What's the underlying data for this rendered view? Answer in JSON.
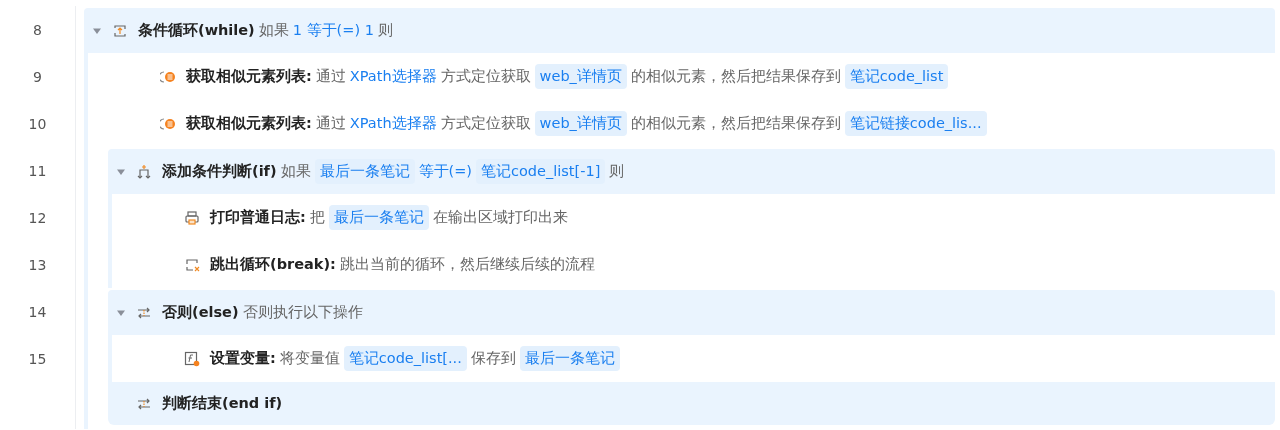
{
  "steps": [
    {
      "line": "8",
      "kind": "while",
      "expanded": true,
      "title": "条件循环(while)",
      "parts": [
        {
          "kind": "text",
          "text": "如果"
        },
        {
          "kind": "link",
          "text": "1 等于(=) 1"
        },
        {
          "kind": "text",
          "text": "则"
        }
      ],
      "children": [
        {
          "line": "9",
          "kind": "get-elements",
          "title": "获取相似元素列表:",
          "parts": [
            {
              "kind": "text",
              "text": "通过"
            },
            {
              "kind": "link",
              "text": "XPath选择器"
            },
            {
              "kind": "text",
              "text": "方式定位获取"
            },
            {
              "kind": "tag",
              "text": "web_详情页"
            },
            {
              "kind": "text",
              "text": "的相似元素，然后把结果保存到"
            },
            {
              "kind": "tag",
              "text": "笔记code_list"
            }
          ]
        },
        {
          "line": "10",
          "kind": "get-elements",
          "title": "获取相似元素列表:",
          "parts": [
            {
              "kind": "text",
              "text": "通过"
            },
            {
              "kind": "link",
              "text": "XPath选择器"
            },
            {
              "kind": "text",
              "text": "方式定位获取"
            },
            {
              "kind": "tag",
              "text": "web_详情页"
            },
            {
              "kind": "text",
              "text": "的相似元素，然后把结果保存到"
            },
            {
              "kind": "tag",
              "text": "笔记链接code_lis..."
            }
          ]
        },
        {
          "line": "11",
          "kind": "if",
          "expanded": true,
          "title": "添加条件判断(if)",
          "parts": [
            {
              "kind": "text",
              "text": "如果"
            },
            {
              "kind": "tag",
              "text": "最后一条笔记"
            },
            {
              "kind": "link",
              "text": "等于(=)"
            },
            {
              "kind": "tag",
              "text": "笔记code_list[-1]"
            },
            {
              "kind": "text",
              "text": "则"
            }
          ],
          "children": [
            {
              "line": "12",
              "kind": "print",
              "title": "打印普通日志:",
              "parts": [
                {
                  "kind": "text",
                  "text": "把"
                },
                {
                  "kind": "tag",
                  "text": "最后一条笔记"
                },
                {
                  "kind": "text",
                  "text": "在输出区域打印出来"
                }
              ]
            },
            {
              "line": "13",
              "kind": "break",
              "title": "跳出循环(break):",
              "parts": [
                {
                  "kind": "text",
                  "text": "跳出当前的循环，然后继续后续的流程"
                }
              ]
            }
          ]
        },
        {
          "line": "14",
          "kind": "else",
          "expanded": true,
          "title": "否则(else)",
          "parts": [
            {
              "kind": "text",
              "text": "否则执行以下操作"
            }
          ],
          "children": [
            {
              "line": "15",
              "kind": "set-variable",
              "title": "设置变量:",
              "parts": [
                {
                  "kind": "text",
                  "text": "将变量值"
                },
                {
                  "kind": "tag",
                  "text": "笔记code_list[..."
                },
                {
                  "kind": "text",
                  "text": "保存到"
                },
                {
                  "kind": "tag",
                  "text": "最后一条笔记"
                }
              ]
            }
          ]
        },
        {
          "kind": "end-if",
          "title": "判断结束(end if)"
        }
      ]
    }
  ]
}
